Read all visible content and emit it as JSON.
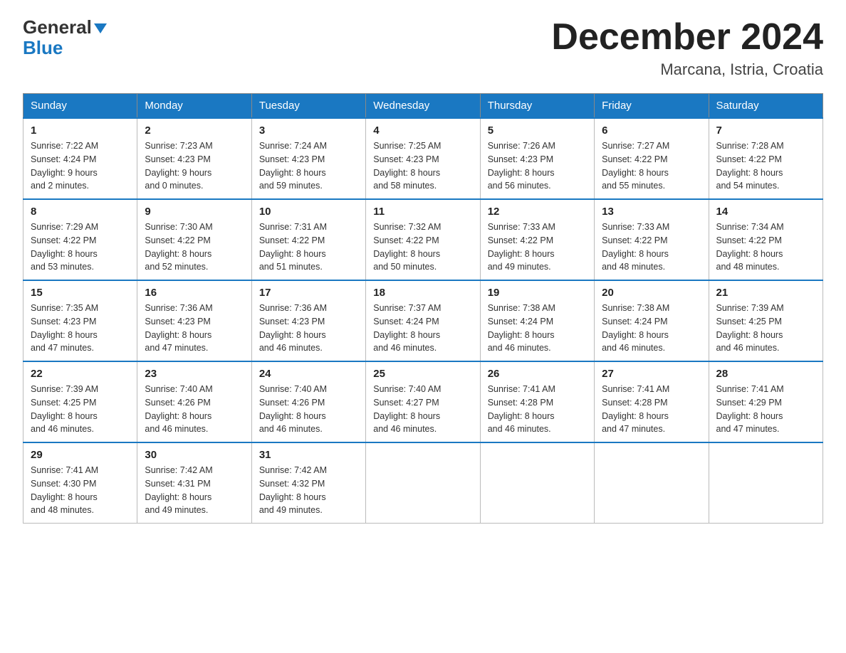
{
  "header": {
    "logo_line1": "General",
    "logo_line2": "Blue",
    "month_title": "December 2024",
    "location": "Marcana, Istria, Croatia"
  },
  "days_of_week": [
    "Sunday",
    "Monday",
    "Tuesday",
    "Wednesday",
    "Thursday",
    "Friday",
    "Saturday"
  ],
  "weeks": [
    [
      {
        "num": "1",
        "sunrise": "7:22 AM",
        "sunset": "4:24 PM",
        "daylight": "9 hours and 2 minutes."
      },
      {
        "num": "2",
        "sunrise": "7:23 AM",
        "sunset": "4:23 PM",
        "daylight": "9 hours and 0 minutes."
      },
      {
        "num": "3",
        "sunrise": "7:24 AM",
        "sunset": "4:23 PM",
        "daylight": "8 hours and 59 minutes."
      },
      {
        "num": "4",
        "sunrise": "7:25 AM",
        "sunset": "4:23 PM",
        "daylight": "8 hours and 58 minutes."
      },
      {
        "num": "5",
        "sunrise": "7:26 AM",
        "sunset": "4:23 PM",
        "daylight": "8 hours and 56 minutes."
      },
      {
        "num": "6",
        "sunrise": "7:27 AM",
        "sunset": "4:22 PM",
        "daylight": "8 hours and 55 minutes."
      },
      {
        "num": "7",
        "sunrise": "7:28 AM",
        "sunset": "4:22 PM",
        "daylight": "8 hours and 54 minutes."
      }
    ],
    [
      {
        "num": "8",
        "sunrise": "7:29 AM",
        "sunset": "4:22 PM",
        "daylight": "8 hours and 53 minutes."
      },
      {
        "num": "9",
        "sunrise": "7:30 AM",
        "sunset": "4:22 PM",
        "daylight": "8 hours and 52 minutes."
      },
      {
        "num": "10",
        "sunrise": "7:31 AM",
        "sunset": "4:22 PM",
        "daylight": "8 hours and 51 minutes."
      },
      {
        "num": "11",
        "sunrise": "7:32 AM",
        "sunset": "4:22 PM",
        "daylight": "8 hours and 50 minutes."
      },
      {
        "num": "12",
        "sunrise": "7:33 AM",
        "sunset": "4:22 PM",
        "daylight": "8 hours and 49 minutes."
      },
      {
        "num": "13",
        "sunrise": "7:33 AM",
        "sunset": "4:22 PM",
        "daylight": "8 hours and 48 minutes."
      },
      {
        "num": "14",
        "sunrise": "7:34 AM",
        "sunset": "4:22 PM",
        "daylight": "8 hours and 48 minutes."
      }
    ],
    [
      {
        "num": "15",
        "sunrise": "7:35 AM",
        "sunset": "4:23 PM",
        "daylight": "8 hours and 47 minutes."
      },
      {
        "num": "16",
        "sunrise": "7:36 AM",
        "sunset": "4:23 PM",
        "daylight": "8 hours and 47 minutes."
      },
      {
        "num": "17",
        "sunrise": "7:36 AM",
        "sunset": "4:23 PM",
        "daylight": "8 hours and 46 minutes."
      },
      {
        "num": "18",
        "sunrise": "7:37 AM",
        "sunset": "4:24 PM",
        "daylight": "8 hours and 46 minutes."
      },
      {
        "num": "19",
        "sunrise": "7:38 AM",
        "sunset": "4:24 PM",
        "daylight": "8 hours and 46 minutes."
      },
      {
        "num": "20",
        "sunrise": "7:38 AM",
        "sunset": "4:24 PM",
        "daylight": "8 hours and 46 minutes."
      },
      {
        "num": "21",
        "sunrise": "7:39 AM",
        "sunset": "4:25 PM",
        "daylight": "8 hours and 46 minutes."
      }
    ],
    [
      {
        "num": "22",
        "sunrise": "7:39 AM",
        "sunset": "4:25 PM",
        "daylight": "8 hours and 46 minutes."
      },
      {
        "num": "23",
        "sunrise": "7:40 AM",
        "sunset": "4:26 PM",
        "daylight": "8 hours and 46 minutes."
      },
      {
        "num": "24",
        "sunrise": "7:40 AM",
        "sunset": "4:26 PM",
        "daylight": "8 hours and 46 minutes."
      },
      {
        "num": "25",
        "sunrise": "7:40 AM",
        "sunset": "4:27 PM",
        "daylight": "8 hours and 46 minutes."
      },
      {
        "num": "26",
        "sunrise": "7:41 AM",
        "sunset": "4:28 PM",
        "daylight": "8 hours and 46 minutes."
      },
      {
        "num": "27",
        "sunrise": "7:41 AM",
        "sunset": "4:28 PM",
        "daylight": "8 hours and 47 minutes."
      },
      {
        "num": "28",
        "sunrise": "7:41 AM",
        "sunset": "4:29 PM",
        "daylight": "8 hours and 47 minutes."
      }
    ],
    [
      {
        "num": "29",
        "sunrise": "7:41 AM",
        "sunset": "4:30 PM",
        "daylight": "8 hours and 48 minutes."
      },
      {
        "num": "30",
        "sunrise": "7:42 AM",
        "sunset": "4:31 PM",
        "daylight": "8 hours and 49 minutes."
      },
      {
        "num": "31",
        "sunrise": "7:42 AM",
        "sunset": "4:32 PM",
        "daylight": "8 hours and 49 minutes."
      },
      null,
      null,
      null,
      null
    ]
  ],
  "labels": {
    "sunrise": "Sunrise:",
    "sunset": "Sunset:",
    "daylight": "Daylight:"
  }
}
